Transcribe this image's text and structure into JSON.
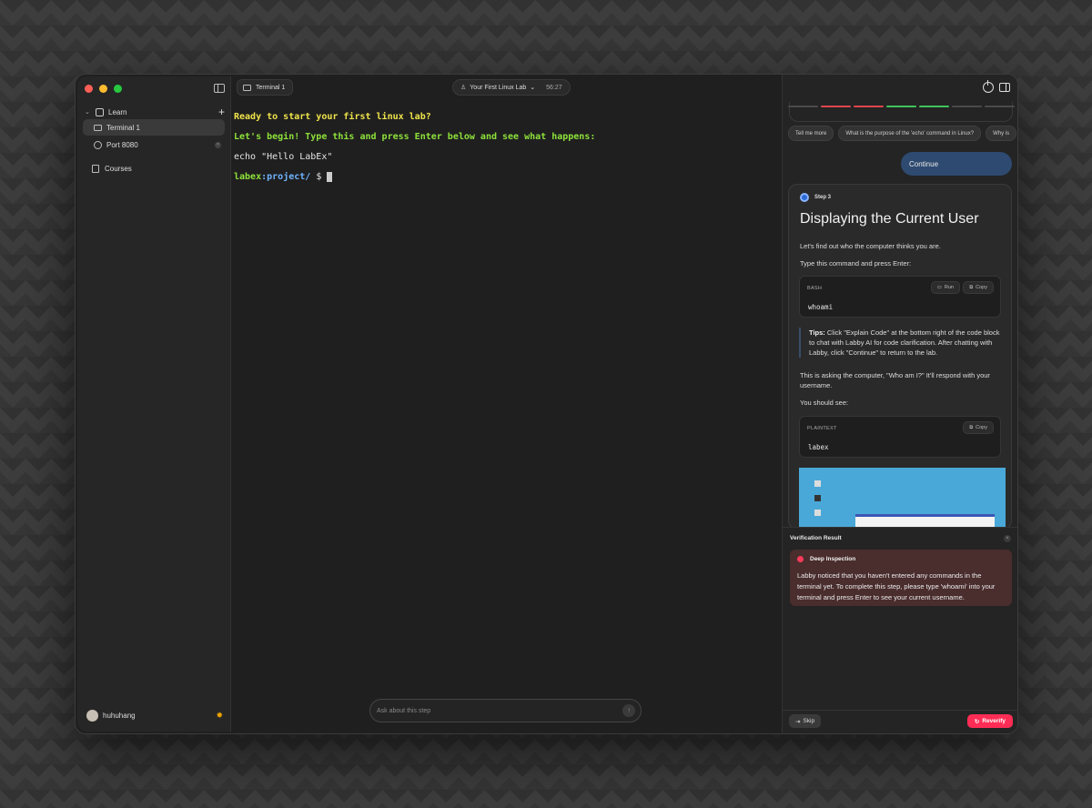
{
  "sidebar": {
    "section_label": "Learn",
    "items": [
      {
        "label": "Terminal 1"
      },
      {
        "label": "Port 8080"
      },
      {
        "label": "Courses"
      }
    ],
    "username": "huhuhang"
  },
  "main": {
    "tab_label": "Terminal 1",
    "lab_title": "Your First Linux Lab",
    "timer": "56:27",
    "terminal": {
      "line1": "Ready to start your first linux lab?",
      "line2": "Let's begin! Type this and press Enter below and see what happens:",
      "line3": "echo \"Hello LabEx\"",
      "prompt_host": "labex",
      "prompt_path": ":project/",
      "prompt_symbol": " $ "
    },
    "ask_placeholder": "Ask about this step"
  },
  "right_panel": {
    "progress_colors": [
      "#4a4a4a",
      "#e0454c",
      "#e0454c",
      "#3ec45a",
      "#3ec45a",
      "#4a4a4a",
      "#4a4a4a"
    ],
    "chips": [
      "Tell me more",
      "What is the purpose of the 'echo' command in Linux?",
      "Why is"
    ],
    "continue_label": "Continue",
    "step": {
      "label": "Step 3",
      "title": "Displaying the Current User",
      "p1": "Let's find out who the computer thinks you are.",
      "p2": "Type this command and press Enter:",
      "code1": {
        "lang": "BASH",
        "run": "Run",
        "copy": "Copy",
        "code": "whoami"
      },
      "tips_label": "Tips:",
      "tips_text": " Click \"Explain Code\" at the bottom right of the code block to chat with Labby AI for code clarification. After chatting with Labby, click \"Continue\" to return to the lab.",
      "p3": "This is asking the computer, \"Who am I?\" It'll respond with your username.",
      "p4": "You should see:",
      "code2": {
        "lang": "PLAINTEXT",
        "copy": "Copy",
        "code": "labex"
      }
    },
    "verification": {
      "title": "Verification Result",
      "heading": "Deep Inspection",
      "message": "Labby noticed that you haven't entered any commands in the terminal yet. To complete this step, please type 'whoami' into your terminal and press Enter to see your current username."
    },
    "skip_label": "Skip",
    "reverify_label": "Reverify"
  }
}
